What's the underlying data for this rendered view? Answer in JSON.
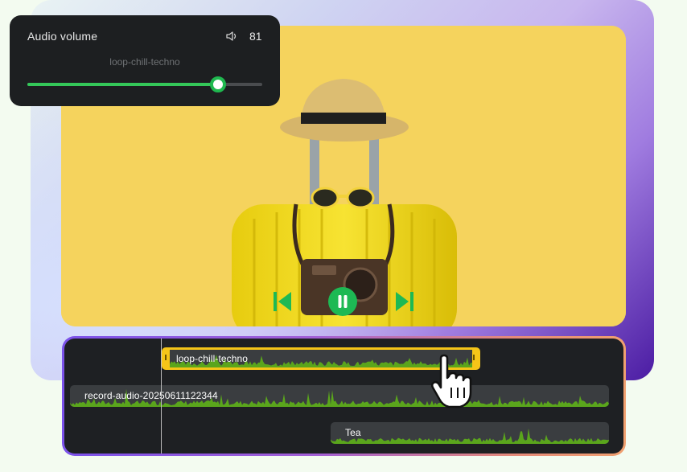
{
  "volume_panel": {
    "title": "Audio volume",
    "value": "81",
    "level_percent": 81,
    "track_name": "loop-chill-techno",
    "accent": "#1fb84f",
    "icon": "speaker-icon"
  },
  "player": {
    "prev_icon": "skip-back-icon",
    "pause_icon": "pause-icon",
    "next_icon": "skip-forward-icon"
  },
  "timeline": {
    "clips": [
      {
        "label": "loop-chill-techno",
        "selected": true
      },
      {
        "label": "record-audio-20250611122344",
        "selected": false
      },
      {
        "label": "Tea",
        "selected": false
      }
    ],
    "waveform_color": "#5aa51c",
    "selected_color": "#f5c518"
  }
}
